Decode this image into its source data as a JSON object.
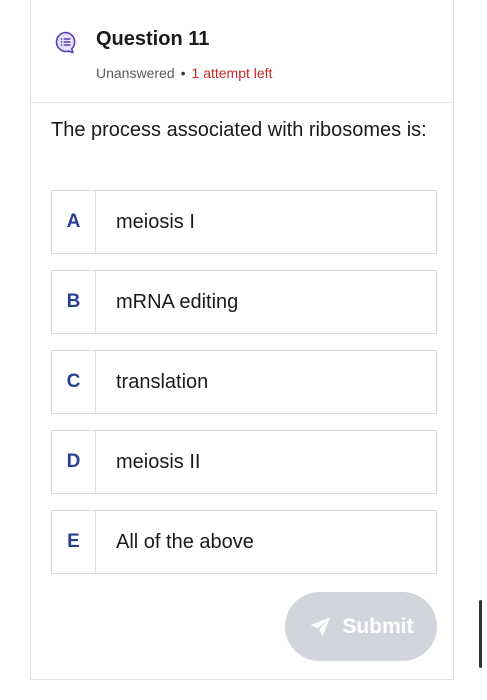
{
  "question": {
    "title": "Question 11",
    "status": "Unanswered",
    "attempts": "1 attempt left",
    "prompt": "The process associated with ribosomes is:"
  },
  "options": [
    {
      "letter": "A",
      "text": "meiosis I"
    },
    {
      "letter": "B",
      "text": "mRNA editing"
    },
    {
      "letter": "C",
      "text": "translation"
    },
    {
      "letter": "D",
      "text": "meiosis II"
    },
    {
      "letter": "E",
      "text": "All of the above"
    }
  ],
  "submit": {
    "label": "Submit",
    "enabled": false
  },
  "icons": {
    "question": "question-list-icon",
    "submit": "send-icon"
  },
  "colors": {
    "accent": "#5a3fb5",
    "attempts": "#c62828",
    "letter": "#2a3f8f",
    "submit_disabled": "#d2d5dc"
  }
}
